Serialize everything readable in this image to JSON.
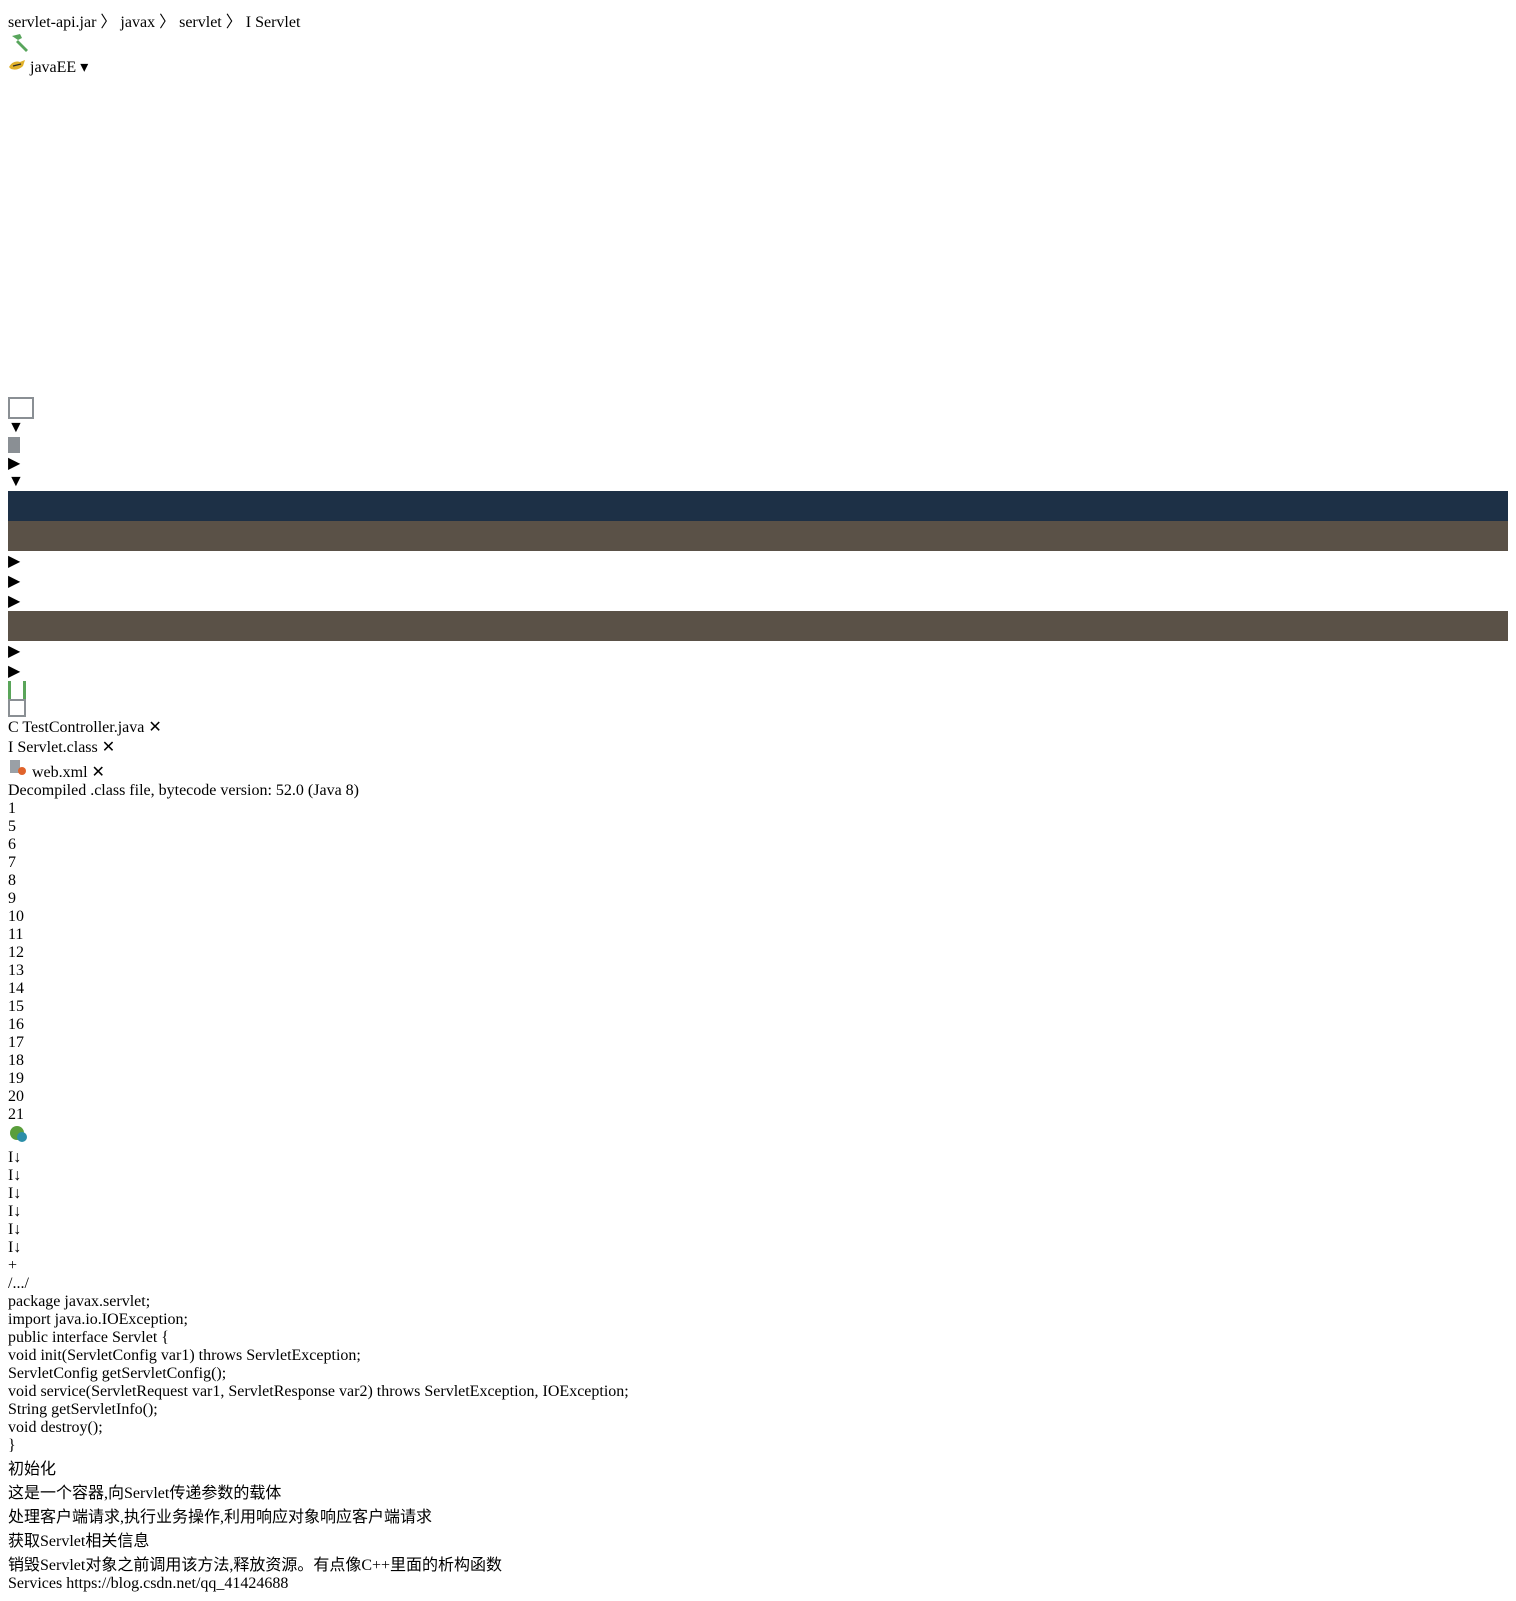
{
  "breadcrumb": {
    "jar": "servlet-api.jar",
    "pkg1": "javax",
    "pkg2": "servlet",
    "cls": "Servlet",
    "cls_badge": "I"
  },
  "run_config": {
    "label": "javaEE"
  },
  "tabs": [
    {
      "label": "TestController.java",
      "icon_letter": "C"
    },
    {
      "label": "Servlet.class",
      "icon_letter": "I"
    },
    {
      "label": "web.xml"
    }
  ],
  "banner": {
    "text": "Decompiled .class file, bytecode version: 52.0 (Java 8)"
  },
  "code": {
    "folded": "/.../",
    "line_numbers": [
      "1",
      "5",
      "6",
      "7",
      "8",
      "9",
      "10",
      "11",
      "12",
      "13",
      "14",
      "15",
      "16",
      "17",
      "18",
      "19",
      "20",
      "21"
    ],
    "l6": {
      "kw": "package",
      "rest": " javax.servlet;"
    },
    "l8": {
      "kw": "import",
      "rest": " java.io.IOException;"
    },
    "l10": {
      "kw1": "public",
      "kw2": "interface",
      "rest": " Servlet {"
    },
    "l11": {
      "kw": "void",
      "mid": " init(ServletConfig var1) ",
      "kw2": "throws",
      "rest": " ServletException;"
    },
    "l13": {
      "text": "ServletConfig getServletConfig();"
    },
    "l15": {
      "kw": "void",
      "mid": " service(ServletRequest var1, ServletResponse var2) ",
      "kw2": "throws",
      "rest": " ServletException, IOException;"
    },
    "l17": {
      "text": "String getServletInfo();"
    },
    "l19": {
      "kw": "void",
      "rest": " destroy();"
    },
    "l20": {
      "text": "}"
    }
  },
  "annotations": {
    "a1": "初始化",
    "a2": "这是一个容器,向Servlet传递参数的载体",
    "a3": "处理客户端请求,执行业务操作,利用响应对象响应客户端请求",
    "a4": "获取Servlet相关信息",
    "a5": "销毁Servlet对象之前调用该方法,释放资源。有点像C++里面的析构函数"
  },
  "gutter_icon_letter": "I",
  "statusbar": {
    "services": "Services",
    "watermark": "https://blog.csdn.net/qq_41424688"
  },
  "colors": {
    "keyword": "#4b9fd5",
    "annotation": "#ff3b30",
    "interface_icon": "#5a9e3c",
    "banner_bg": "#1f3a5a"
  }
}
